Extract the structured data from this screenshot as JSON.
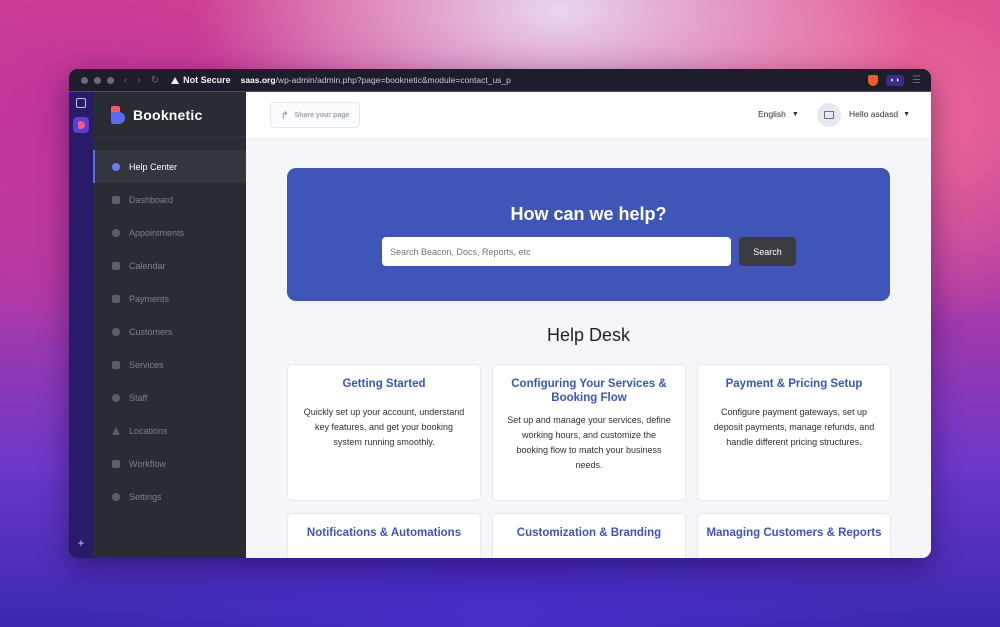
{
  "browser": {
    "security_label": "Not Secure",
    "url_host": "saas.org",
    "url_path": "/wp-admin/admin.php?page=booknetic&module=contact_us_p"
  },
  "brand": {
    "name": "Booknetic"
  },
  "sidebar": {
    "items": [
      {
        "label": "Help Center",
        "active": true
      },
      {
        "label": "Dashboard"
      },
      {
        "label": "Appointments"
      },
      {
        "label": "Calendar"
      },
      {
        "label": "Payments"
      },
      {
        "label": "Customers"
      },
      {
        "label": "Services"
      },
      {
        "label": "Staff"
      },
      {
        "label": "Locations"
      },
      {
        "label": "Workflow"
      },
      {
        "label": "Settings"
      }
    ]
  },
  "topbar": {
    "share_label": "Share your page",
    "language": "English",
    "user_greeting": "Hello asdasd"
  },
  "hero": {
    "title": "How can we help?",
    "search_placeholder": "Search Beacon, Docs, Reports, etc",
    "search_button": "Search"
  },
  "helpdesk": {
    "title": "Help Desk",
    "cards": [
      {
        "title": "Getting Started",
        "text": "Quickly set up your account, understand key features, and get your booking system running smoothly."
      },
      {
        "title": "Configuring Your Services & Booking Flow",
        "text": "Set up and manage your services, define working hours, and customize the booking flow to match your business needs."
      },
      {
        "title": "Payment & Pricing Setup",
        "text": "Configure payment gateways, set up deposit payments, manage refunds, and handle different pricing structures."
      },
      {
        "title": "Notifications & Automations",
        "text": ""
      },
      {
        "title": "Customization & Branding",
        "text": ""
      },
      {
        "title": "Managing Customers & Reports",
        "text": ""
      }
    ]
  },
  "colors": {
    "accent": "#3f55b8",
    "sidebar_bg": "#292c33",
    "search_button_bg": "#3a3c42"
  }
}
